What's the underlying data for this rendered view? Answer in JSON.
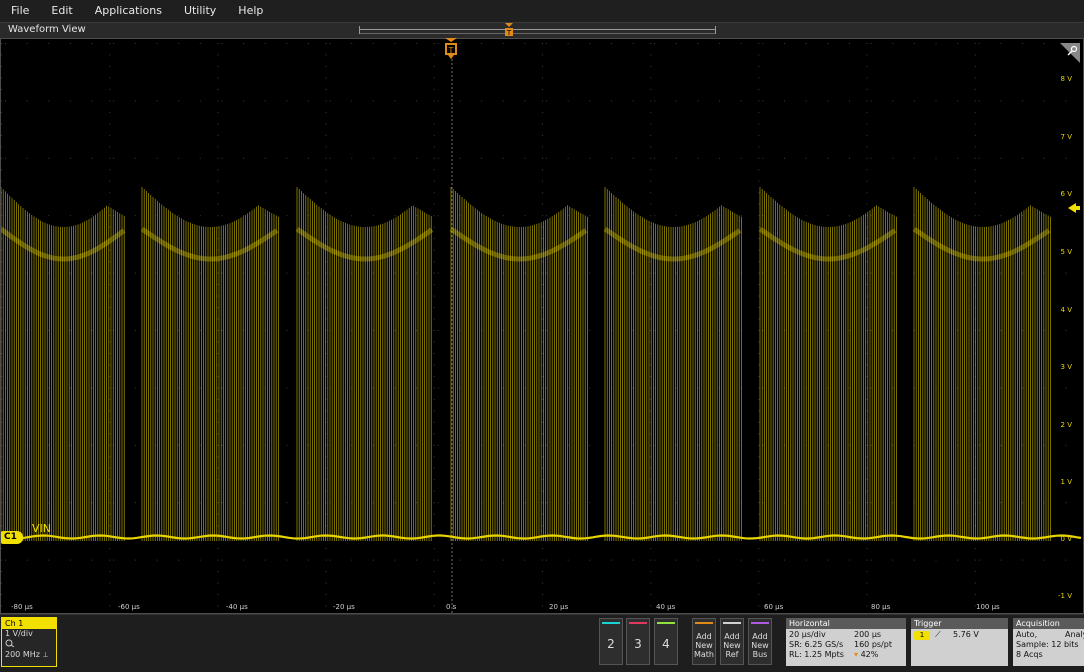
{
  "menu": [
    "File",
    "Edit",
    "Applications",
    "Utility",
    "Help"
  ],
  "waveform_view": {
    "title": "Waveform View",
    "trigger_marker_label": "T",
    "channel_marker": "C1",
    "channel_label": "VIN",
    "time_ticks": [
      "-80 µs",
      "-60 µs",
      "-40 µs",
      "-20 µs",
      "0 s",
      "20 µs",
      "40 µs",
      "60 µs",
      "80 µs",
      "100 µs"
    ],
    "volt_ticks": [
      "8 V",
      "7 V",
      "6 V",
      "5 V",
      "4 V",
      "3 V",
      "2 V",
      "1 V",
      "0 V",
      "-1 V"
    ],
    "trace_color": "#e8d500"
  },
  "ch1": {
    "title": "Ch 1",
    "scale": "1 V/div",
    "bandwidth": "200 MHz"
  },
  "channel_buttons": [
    {
      "label": "2",
      "color": "#19d3d3"
    },
    {
      "label": "3",
      "color": "#e0385f"
    },
    {
      "label": "4",
      "color": "#8ee23a"
    }
  ],
  "add_buttons": [
    {
      "line1": "Add",
      "line2": "New",
      "line3": "Math",
      "color": "#e08a1a"
    },
    {
      "line1": "Add",
      "line2": "New",
      "line3": "Ref",
      "color": "#d0d0d0"
    },
    {
      "line1": "Add",
      "line2": "New",
      "line3": "Bus",
      "color": "#b15be0"
    }
  ],
  "horizontal": {
    "title": "Horizontal",
    "scale": "20 µs/div",
    "record_time": "200 µs",
    "sample_rate": "SR: 6.25 GS/s",
    "resolution": "160 ps/pt",
    "record_length": "RL: 1.25 Mpts",
    "position": "42%"
  },
  "trigger": {
    "title": "Trigger",
    "source": "1",
    "level": "5.76 V"
  },
  "acquisition": {
    "title": "Acquisition",
    "mode": "Auto,",
    "type": "Analy",
    "sample": "Sample: 12 bits",
    "acqs": "8 Acqs"
  }
}
